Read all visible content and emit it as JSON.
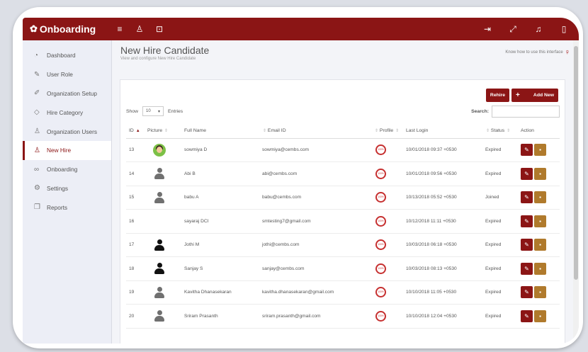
{
  "app": {
    "title": "Onboarding",
    "brand_color": "#8b1515"
  },
  "topbar": {
    "left_icons": [
      "menu-icon",
      "user-icon",
      "lock-icon"
    ],
    "right_icons": [
      "logout-icon",
      "expand-icon",
      "bell-icon",
      "window-icon"
    ]
  },
  "sidebar": {
    "items": [
      {
        "label": "Dashboard",
        "icon": "dashboard-icon",
        "glyph": "◔"
      },
      {
        "label": "User Role",
        "icon": "edit-icon",
        "glyph": "✎"
      },
      {
        "label": "Organization Setup",
        "icon": "pen-icon",
        "glyph": "✐"
      },
      {
        "label": "Hire Category",
        "icon": "tag-icon",
        "glyph": "◇"
      },
      {
        "label": "Organization Users",
        "icon": "users-icon",
        "glyph": "♙"
      },
      {
        "label": "New Hire",
        "icon": "user-icon",
        "glyph": "♙",
        "active": true
      },
      {
        "label": "Onboarding",
        "icon": "link-icon",
        "glyph": "∞"
      },
      {
        "label": "Settings",
        "icon": "gear-icon",
        "glyph": "⚙"
      },
      {
        "label": "Reports",
        "icon": "copy-icon",
        "glyph": "❐"
      }
    ]
  },
  "page": {
    "title": "New Hire Candidate",
    "subtitle": "View and configure New Hire Candidate",
    "help_text": "Know how to use this interface"
  },
  "buttons": {
    "rehire": "Rehire",
    "add_new": "Add New"
  },
  "controls": {
    "show_label": "Show",
    "entries_value": "10",
    "entries_label": "Entries",
    "search_label": "Search:",
    "search_value": ""
  },
  "table": {
    "headers": {
      "id": "ID",
      "picture": "Picture",
      "full_name": "Full Name",
      "email": "Email ID",
      "profile": "Profile",
      "last_login": "Last Login",
      "status": "Status",
      "action": "Action"
    },
    "rows": [
      {
        "id": "13",
        "avatar": "photo",
        "name": "sowmiya D",
        "email": "sowmiya@cembs.com",
        "profile": "100%",
        "last_login": "10/01/2018 09:37 +0530",
        "status": "Expired"
      },
      {
        "id": "14",
        "avatar": "gray",
        "name": "Abi B",
        "email": "abi@cembs.com",
        "profile": "100%",
        "last_login": "10/01/2018 09:56 +0530",
        "status": "Expired"
      },
      {
        "id": "15",
        "avatar": "gray",
        "name": "babu A",
        "email": "babu@cembs.com",
        "profile": "100%",
        "last_login": "10/13/2018 05:52 +0530",
        "status": "Joined"
      },
      {
        "id": "16",
        "avatar": "none",
        "name": "sayaraj DCI",
        "email": "smtesting7@gmail.com",
        "profile": "100%",
        "last_login": "10/12/2018 11:11 +0530",
        "status": "Expired"
      },
      {
        "id": "17",
        "avatar": "black",
        "name": "Jothi M",
        "email": "jothi@cembs.com",
        "profile": "100%",
        "last_login": "10/03/2018 06:18 +0530",
        "status": "Expired"
      },
      {
        "id": "18",
        "avatar": "black",
        "name": "Sanjay S",
        "email": "sanjay@cembs.com",
        "profile": "100%",
        "last_login": "10/03/2018 08:13 +0530",
        "status": "Expired"
      },
      {
        "id": "19",
        "avatar": "gray",
        "name": "Kavitha Dhanasekaran",
        "email": "kavitha.dhanasekaran@gmail.com",
        "profile": "100%",
        "last_login": "10/10/2018 11:05 +0530",
        "status": "Expired"
      },
      {
        "id": "20",
        "avatar": "gray",
        "name": "Sriram Prasanth",
        "email": "sriram.prasanth@gmail.com",
        "profile": "100%",
        "last_login": "10/10/2018 12:04 +0530",
        "status": "Expired"
      }
    ]
  }
}
